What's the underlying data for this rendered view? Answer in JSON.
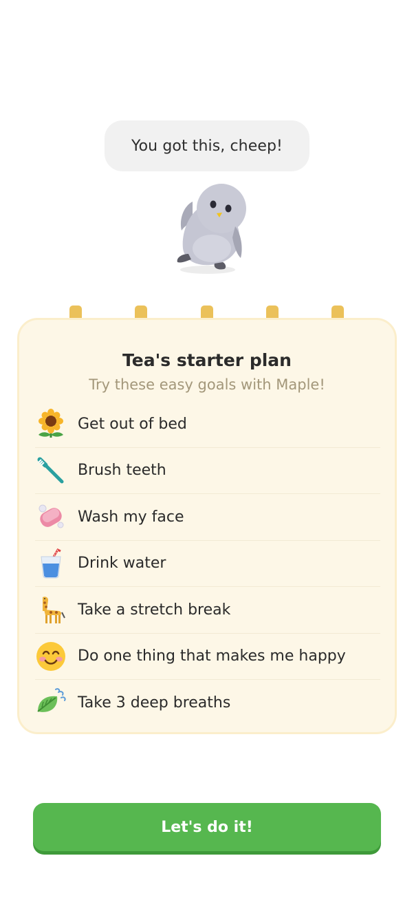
{
  "mascot": {
    "speech": "You got this, cheep!"
  },
  "plan": {
    "title": "Tea's starter plan",
    "subtitle": "Try these easy goals with Maple!",
    "goals": [
      {
        "icon": "sunflower-icon",
        "label": "Get out of bed"
      },
      {
        "icon": "toothbrush-icon",
        "label": "Brush teeth"
      },
      {
        "icon": "soap-icon",
        "label": "Wash my face"
      },
      {
        "icon": "water-cup-icon",
        "label": "Drink water"
      },
      {
        "icon": "giraffe-icon",
        "label": "Take a stretch break"
      },
      {
        "icon": "smiling-face-icon",
        "label": "Do one thing that makes me happy"
      },
      {
        "icon": "leaf-breeze-icon",
        "label": "Take 3 deep breaths"
      }
    ]
  },
  "cta": {
    "label": "Let's do it!"
  },
  "colors": {
    "primary": "#56b74f",
    "card_bg": "#fdf7e7",
    "ring": "#ebc15a",
    "subtitle": "#a3977a"
  }
}
